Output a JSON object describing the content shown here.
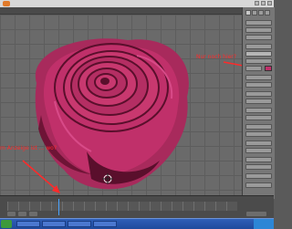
{
  "window": {
    "title": ""
  },
  "annotations": {
    "top_right": "Nur noch hier?",
    "bottom_left": "m Anzeige ist ... wo?"
  },
  "colors": {
    "annotation": "#ff2a2a",
    "rose_main": "#c0306a",
    "rose_dark": "#5a0f2c",
    "rose_light": "#d84a88"
  },
  "icons": {
    "cursor": "3d-cursor-icon",
    "logo": "app-logo-icon"
  }
}
